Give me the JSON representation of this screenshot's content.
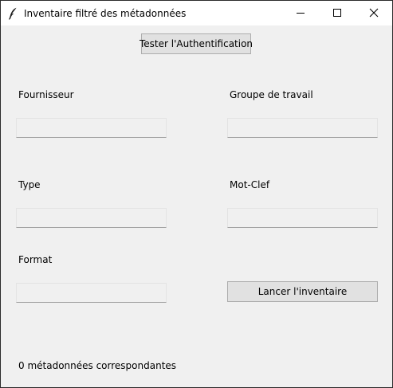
{
  "window": {
    "title": "Inventaire filtré des métadonnées",
    "icon": "feather-icon",
    "controls": [
      "minimize-icon",
      "maximize-icon",
      "close-icon"
    ]
  },
  "toolbar": {
    "auth_button_label": "Tester l'Authentification"
  },
  "form": {
    "fournisseur": {
      "label": "Fournisseur",
      "value": ""
    },
    "groupe": {
      "label": "Groupe de travail",
      "value": ""
    },
    "type": {
      "label": "Type",
      "value": ""
    },
    "motclef": {
      "label": "Mot-Clef",
      "value": ""
    },
    "format": {
      "label": "Format",
      "value": ""
    }
  },
  "actions": {
    "run_button_label": "Lancer l'inventaire"
  },
  "status": {
    "count_text": "0 métadonnées correspondantes"
  }
}
